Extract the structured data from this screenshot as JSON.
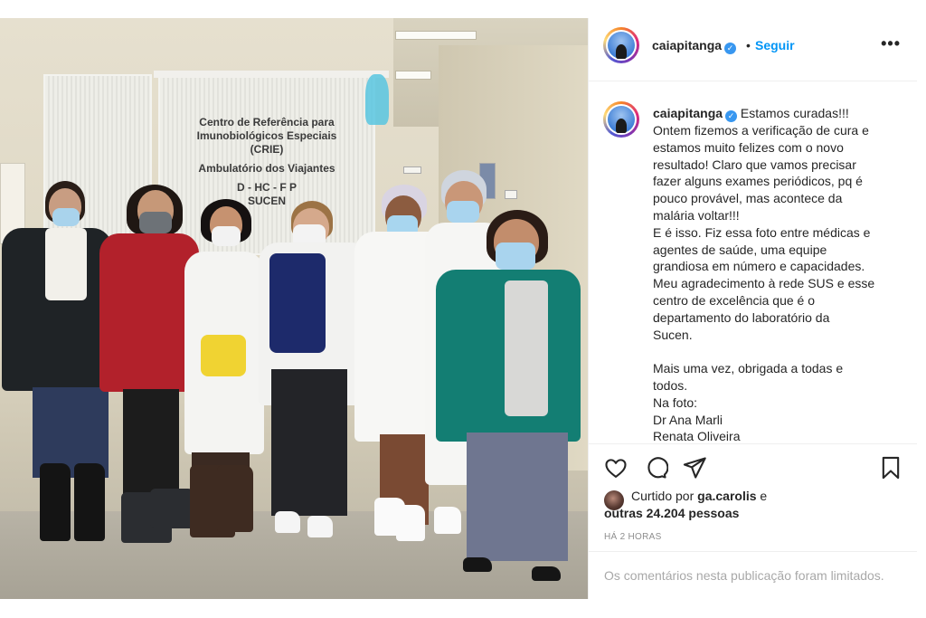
{
  "post": {
    "username": "caiapitanga",
    "separator": "•",
    "follow_label": "Seguir",
    "more_label": "•••",
    "photo_sign": [
      "Centro de Referência para",
      "Imunobiológicos Especiais",
      "(CRIE)",
      "Ambulatório dos Viajantes",
      "D     - HC - F     P",
      "SUCEN"
    ],
    "caption": {
      "first_line_after_user": "Estamos curadas!!!",
      "lines": [
        "Ontem fizemos a verificação de cura e",
        "estamos muito felizes com o novo",
        "resultado! Claro que vamos precisar",
        "fazer alguns exames periódicos, pq é",
        "pouco provável, mas acontece da",
        "malária voltar!!!",
        "E é isso. Fiz essa foto entre médicas e",
        "agentes de saúde, uma equipe",
        "grandiosa em número e capacidades.",
        "Meu agradecimento à rede SUS e esse",
        "centro de excelência que é o",
        "departamento do laboratório da",
        "Sucen.",
        "",
        "Mais uma vez, obrigada a todas e",
        "todos.",
        "Na foto:",
        "Dr Ana Marli",
        "Renata Oliveira"
      ]
    },
    "likes": {
      "prefix": "Curtido por",
      "liker": "ga.carolis",
      "conjunction": "e",
      "others": "outras 24.204 pessoas"
    },
    "time": "HÁ 2 HORAS",
    "comments_limited": "Os comentários nesta publicação foram limitados."
  },
  "icons": {
    "like": "heart-icon",
    "comment": "comment-icon",
    "share": "send-icon",
    "save": "bookmark-icon"
  },
  "colors": {
    "link": "#0095f6",
    "verified": "#3897f0",
    "muted": "#8e8e8e"
  }
}
